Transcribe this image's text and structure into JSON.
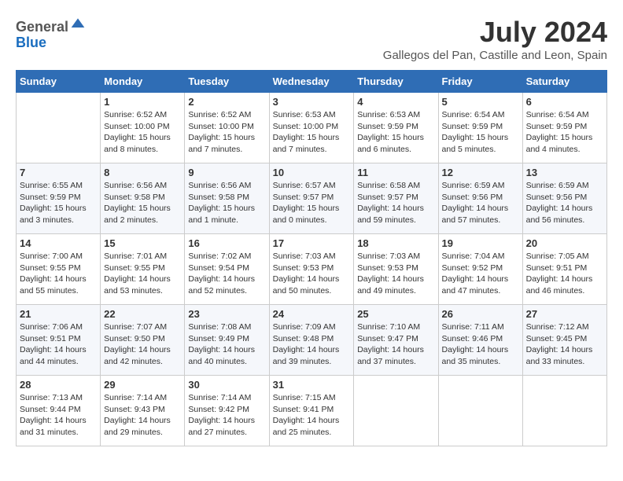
{
  "header": {
    "logo_line1": "General",
    "logo_line2": "Blue",
    "month_year": "July 2024",
    "location": "Gallegos del Pan, Castille and Leon, Spain"
  },
  "weekdays": [
    "Sunday",
    "Monday",
    "Tuesday",
    "Wednesday",
    "Thursday",
    "Friday",
    "Saturday"
  ],
  "weeks": [
    [
      {
        "day": "",
        "sunrise": "",
        "sunset": "",
        "daylight": ""
      },
      {
        "day": "1",
        "sunrise": "Sunrise: 6:52 AM",
        "sunset": "Sunset: 10:00 PM",
        "daylight": "Daylight: 15 hours and 8 minutes."
      },
      {
        "day": "2",
        "sunrise": "Sunrise: 6:52 AM",
        "sunset": "Sunset: 10:00 PM",
        "daylight": "Daylight: 15 hours and 7 minutes."
      },
      {
        "day": "3",
        "sunrise": "Sunrise: 6:53 AM",
        "sunset": "Sunset: 10:00 PM",
        "daylight": "Daylight: 15 hours and 7 minutes."
      },
      {
        "day": "4",
        "sunrise": "Sunrise: 6:53 AM",
        "sunset": "Sunset: 9:59 PM",
        "daylight": "Daylight: 15 hours and 6 minutes."
      },
      {
        "day": "5",
        "sunrise": "Sunrise: 6:54 AM",
        "sunset": "Sunset: 9:59 PM",
        "daylight": "Daylight: 15 hours and 5 minutes."
      },
      {
        "day": "6",
        "sunrise": "Sunrise: 6:54 AM",
        "sunset": "Sunset: 9:59 PM",
        "daylight": "Daylight: 15 hours and 4 minutes."
      }
    ],
    [
      {
        "day": "7",
        "sunrise": "Sunrise: 6:55 AM",
        "sunset": "Sunset: 9:59 PM",
        "daylight": "Daylight: 15 hours and 3 minutes."
      },
      {
        "day": "8",
        "sunrise": "Sunrise: 6:56 AM",
        "sunset": "Sunset: 9:58 PM",
        "daylight": "Daylight: 15 hours and 2 minutes."
      },
      {
        "day": "9",
        "sunrise": "Sunrise: 6:56 AM",
        "sunset": "Sunset: 9:58 PM",
        "daylight": "Daylight: 15 hours and 1 minute."
      },
      {
        "day": "10",
        "sunrise": "Sunrise: 6:57 AM",
        "sunset": "Sunset: 9:57 PM",
        "daylight": "Daylight: 15 hours and 0 minutes."
      },
      {
        "day": "11",
        "sunrise": "Sunrise: 6:58 AM",
        "sunset": "Sunset: 9:57 PM",
        "daylight": "Daylight: 14 hours and 59 minutes."
      },
      {
        "day": "12",
        "sunrise": "Sunrise: 6:59 AM",
        "sunset": "Sunset: 9:56 PM",
        "daylight": "Daylight: 14 hours and 57 minutes."
      },
      {
        "day": "13",
        "sunrise": "Sunrise: 6:59 AM",
        "sunset": "Sunset: 9:56 PM",
        "daylight": "Daylight: 14 hours and 56 minutes."
      }
    ],
    [
      {
        "day": "14",
        "sunrise": "Sunrise: 7:00 AM",
        "sunset": "Sunset: 9:55 PM",
        "daylight": "Daylight: 14 hours and 55 minutes."
      },
      {
        "day": "15",
        "sunrise": "Sunrise: 7:01 AM",
        "sunset": "Sunset: 9:55 PM",
        "daylight": "Daylight: 14 hours and 53 minutes."
      },
      {
        "day": "16",
        "sunrise": "Sunrise: 7:02 AM",
        "sunset": "Sunset: 9:54 PM",
        "daylight": "Daylight: 14 hours and 52 minutes."
      },
      {
        "day": "17",
        "sunrise": "Sunrise: 7:03 AM",
        "sunset": "Sunset: 9:53 PM",
        "daylight": "Daylight: 14 hours and 50 minutes."
      },
      {
        "day": "18",
        "sunrise": "Sunrise: 7:03 AM",
        "sunset": "Sunset: 9:53 PM",
        "daylight": "Daylight: 14 hours and 49 minutes."
      },
      {
        "day": "19",
        "sunrise": "Sunrise: 7:04 AM",
        "sunset": "Sunset: 9:52 PM",
        "daylight": "Daylight: 14 hours and 47 minutes."
      },
      {
        "day": "20",
        "sunrise": "Sunrise: 7:05 AM",
        "sunset": "Sunset: 9:51 PM",
        "daylight": "Daylight: 14 hours and 46 minutes."
      }
    ],
    [
      {
        "day": "21",
        "sunrise": "Sunrise: 7:06 AM",
        "sunset": "Sunset: 9:51 PM",
        "daylight": "Daylight: 14 hours and 44 minutes."
      },
      {
        "day": "22",
        "sunrise": "Sunrise: 7:07 AM",
        "sunset": "Sunset: 9:50 PM",
        "daylight": "Daylight: 14 hours and 42 minutes."
      },
      {
        "day": "23",
        "sunrise": "Sunrise: 7:08 AM",
        "sunset": "Sunset: 9:49 PM",
        "daylight": "Daylight: 14 hours and 40 minutes."
      },
      {
        "day": "24",
        "sunrise": "Sunrise: 7:09 AM",
        "sunset": "Sunset: 9:48 PM",
        "daylight": "Daylight: 14 hours and 39 minutes."
      },
      {
        "day": "25",
        "sunrise": "Sunrise: 7:10 AM",
        "sunset": "Sunset: 9:47 PM",
        "daylight": "Daylight: 14 hours and 37 minutes."
      },
      {
        "day": "26",
        "sunrise": "Sunrise: 7:11 AM",
        "sunset": "Sunset: 9:46 PM",
        "daylight": "Daylight: 14 hours and 35 minutes."
      },
      {
        "day": "27",
        "sunrise": "Sunrise: 7:12 AM",
        "sunset": "Sunset: 9:45 PM",
        "daylight": "Daylight: 14 hours and 33 minutes."
      }
    ],
    [
      {
        "day": "28",
        "sunrise": "Sunrise: 7:13 AM",
        "sunset": "Sunset: 9:44 PM",
        "daylight": "Daylight: 14 hours and 31 minutes."
      },
      {
        "day": "29",
        "sunrise": "Sunrise: 7:14 AM",
        "sunset": "Sunset: 9:43 PM",
        "daylight": "Daylight: 14 hours and 29 minutes."
      },
      {
        "day": "30",
        "sunrise": "Sunrise: 7:14 AM",
        "sunset": "Sunset: 9:42 PM",
        "daylight": "Daylight: 14 hours and 27 minutes."
      },
      {
        "day": "31",
        "sunrise": "Sunrise: 7:15 AM",
        "sunset": "Sunset: 9:41 PM",
        "daylight": "Daylight: 14 hours and 25 minutes."
      },
      {
        "day": "",
        "sunrise": "",
        "sunset": "",
        "daylight": ""
      },
      {
        "day": "",
        "sunrise": "",
        "sunset": "",
        "daylight": ""
      },
      {
        "day": "",
        "sunrise": "",
        "sunset": "",
        "daylight": ""
      }
    ]
  ]
}
